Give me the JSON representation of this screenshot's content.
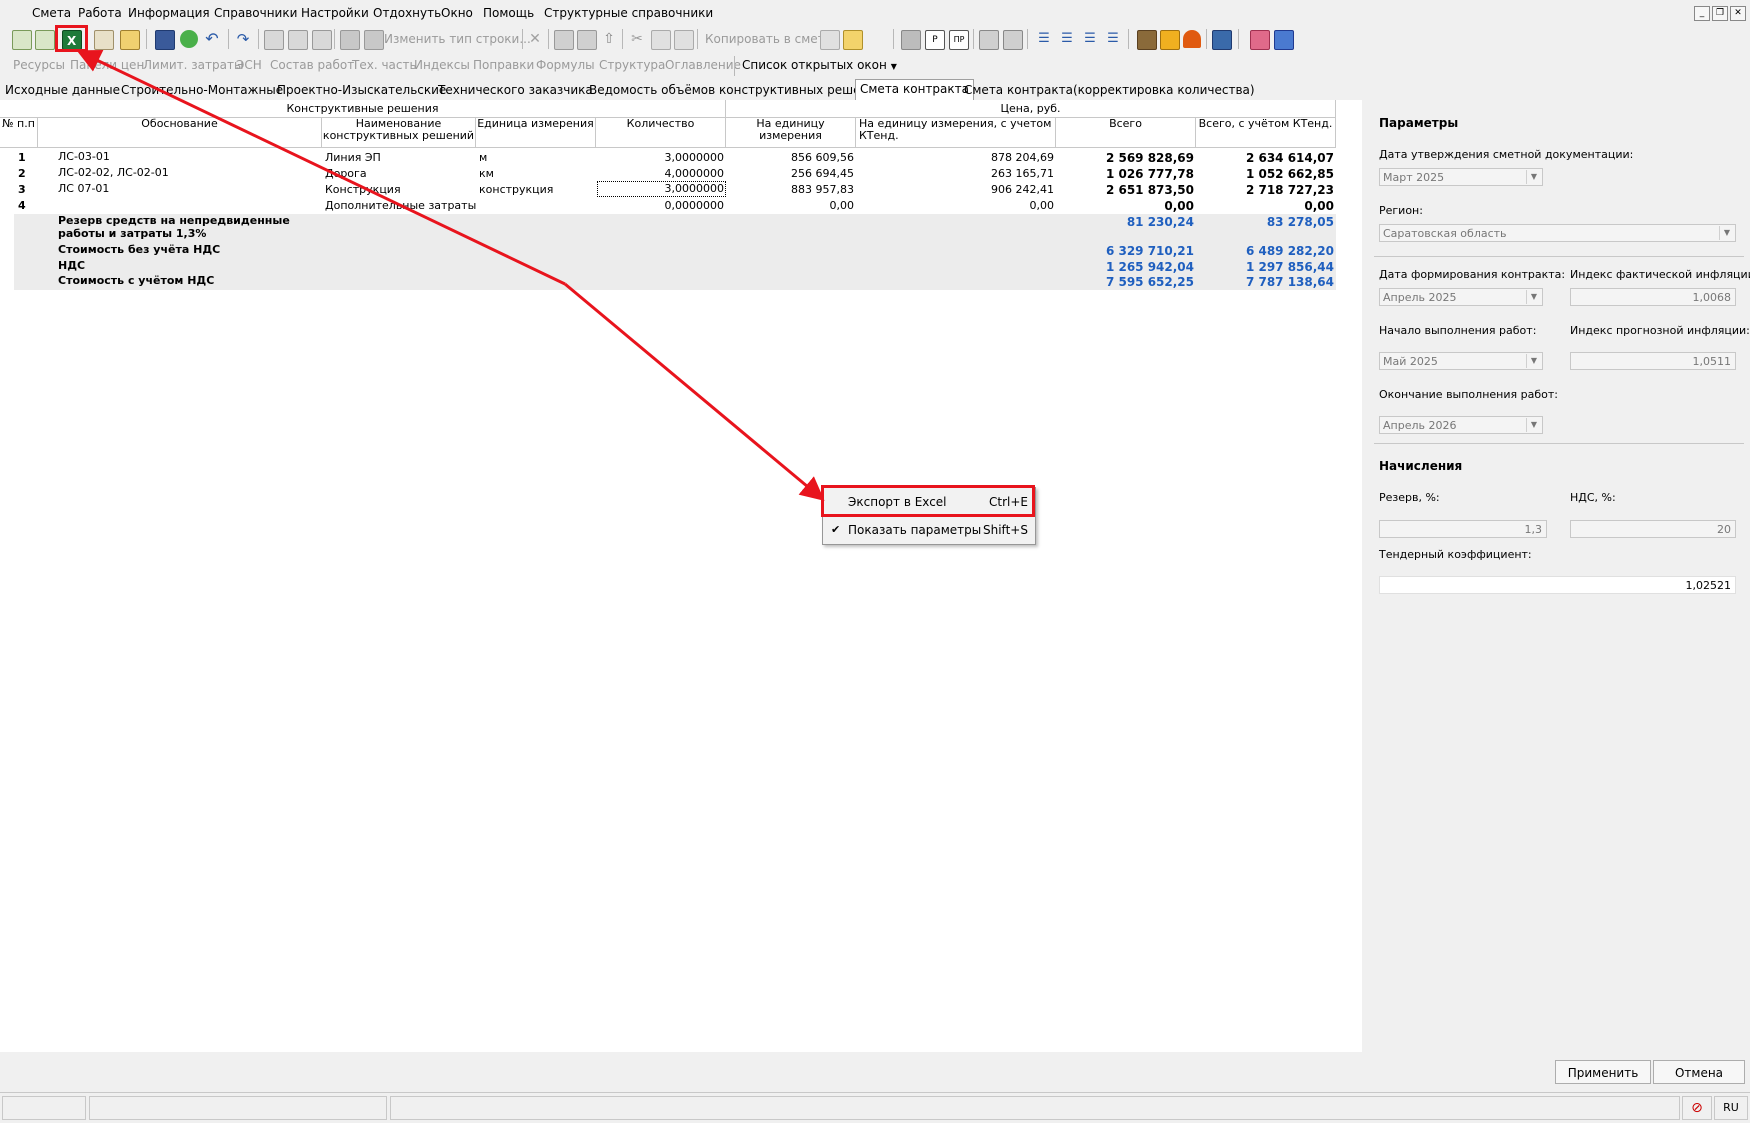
{
  "menu": {
    "items": [
      "Смета",
      "Работа",
      "Информация",
      "Справочники",
      "Настройки",
      "Отдохнуть",
      "Окно",
      "Помощь",
      "Структурные справочники"
    ],
    "window_controls": [
      "_",
      "❐",
      "✕"
    ]
  },
  "toolbar1": {
    "change_row_type": "Изменить тип строки...",
    "copy_to_estimate": "Копировать в смету"
  },
  "toolbar2": {
    "items": [
      "Ресурсы",
      "Панели цен",
      "Лимит. затраты",
      "ЭСН",
      "Состав работ",
      "Тех. часть",
      "Индексы",
      "Поправки",
      "Формулы",
      "Структура",
      "Оглавление"
    ],
    "open_windows": "Список открытых окон"
  },
  "tabs": [
    "Исходные данные",
    "Строительно-Монтажные",
    "Проектно-Изыскательские",
    "Технического заказчика",
    "Ведомость объёмов конструктивных решений",
    "Смета контракта",
    "Смета контракта(корректировка количества)"
  ],
  "active_tab": 5,
  "grid": {
    "group_headers": {
      "design": "Конструктивные решения",
      "price": "Цена, руб."
    },
    "columns": [
      "№ п.п",
      "Обоснование",
      "Наименование конструктивных решений",
      "Единица измерения",
      "Количество",
      "На единицу измерения",
      "На единицу измерения, с учетом КТенд.",
      "Всего",
      "Всего, с учётом КТенд."
    ],
    "rows": [
      {
        "n": "1",
        "basis": "ЛС-03-01",
        "name": "Линия ЭП",
        "unit": "м",
        "qty": "3,0000000",
        "per_unit": "856 609,56",
        "per_unit_k": "878 204,69",
        "total": "2 569 828,69",
        "total_k": "2 634 614,07"
      },
      {
        "n": "2",
        "basis": "ЛС-02-02, ЛС-02-01",
        "name": "Дорога",
        "unit": "км",
        "qty": "4,0000000",
        "per_unit": "256 694,45",
        "per_unit_k": "263 165,71",
        "total": "1 026 777,78",
        "total_k": "1 052 662,85"
      },
      {
        "n": "3",
        "basis": "ЛС 07-01",
        "name": "Конструкция",
        "unit": "конструкция",
        "qty": "3,0000000",
        "per_unit": "883 957,83",
        "per_unit_k": "906 242,41",
        "total": "2 651 873,50",
        "total_k": "2 718 727,23"
      },
      {
        "n": "4",
        "basis": "",
        "name": "Дополнительные затраты",
        "unit": "",
        "qty": "0,0000000",
        "per_unit": "0,00",
        "per_unit_k": "0,00",
        "total": "0,00",
        "total_k": "0,00"
      }
    ],
    "summary": [
      {
        "label": "Резерв средств на непредвиденные работы и затраты 1,3%",
        "total": "81 230,24",
        "total_k": "83 278,05"
      },
      {
        "label": "Стоимость без учёта НДС",
        "total": "6 329 710,21",
        "total_k": "6 489 282,20"
      },
      {
        "label": "НДС",
        "total": "1 265 942,04",
        "total_k": "1 297 856,44"
      },
      {
        "label": "Стоимость с учётом НДС",
        "total": "7 595 652,25",
        "total_k": "7 787 138,64"
      }
    ]
  },
  "panel": {
    "params_title": "Параметры",
    "approval_date_label": "Дата утверждения сметной документации:",
    "approval_date": "Март 2025",
    "region_label": "Регион:",
    "region": "Саратовская область",
    "contract_date_label": "Дата формирования контракта:",
    "contract_date": "Апрель 2025",
    "actual_infl_label": "Индекс фактической инфляции:",
    "actual_infl": "1,0068",
    "start_label": "Начало выполнения работ:",
    "start": "Май 2025",
    "forecast_infl_label": "Индекс прогнозной инфляции:",
    "forecast_infl": "1,0511",
    "end_label": "Окончание выполнения работ:",
    "end": "Апрель 2026",
    "accruals_title": "Начисления",
    "reserve_label": "Резерв, %:",
    "reserve": "1,3",
    "vat_label": "НДС, %:",
    "vat": "20",
    "tender_label": "Тендерный коэффициент:",
    "tender": "1,02521"
  },
  "buttons": {
    "apply": "Применить",
    "cancel": "Отмена"
  },
  "context_menu": [
    {
      "label": "Экспорт в Excel",
      "shortcut": "Ctrl+E"
    },
    {
      "label": "Показать параметры",
      "shortcut": "Shift+S",
      "check": "✔"
    }
  ],
  "statusbar": {
    "lang": "RU"
  },
  "colors": {
    "accent_red": "#e8141d",
    "sum_blue": "#1f5fbf"
  }
}
